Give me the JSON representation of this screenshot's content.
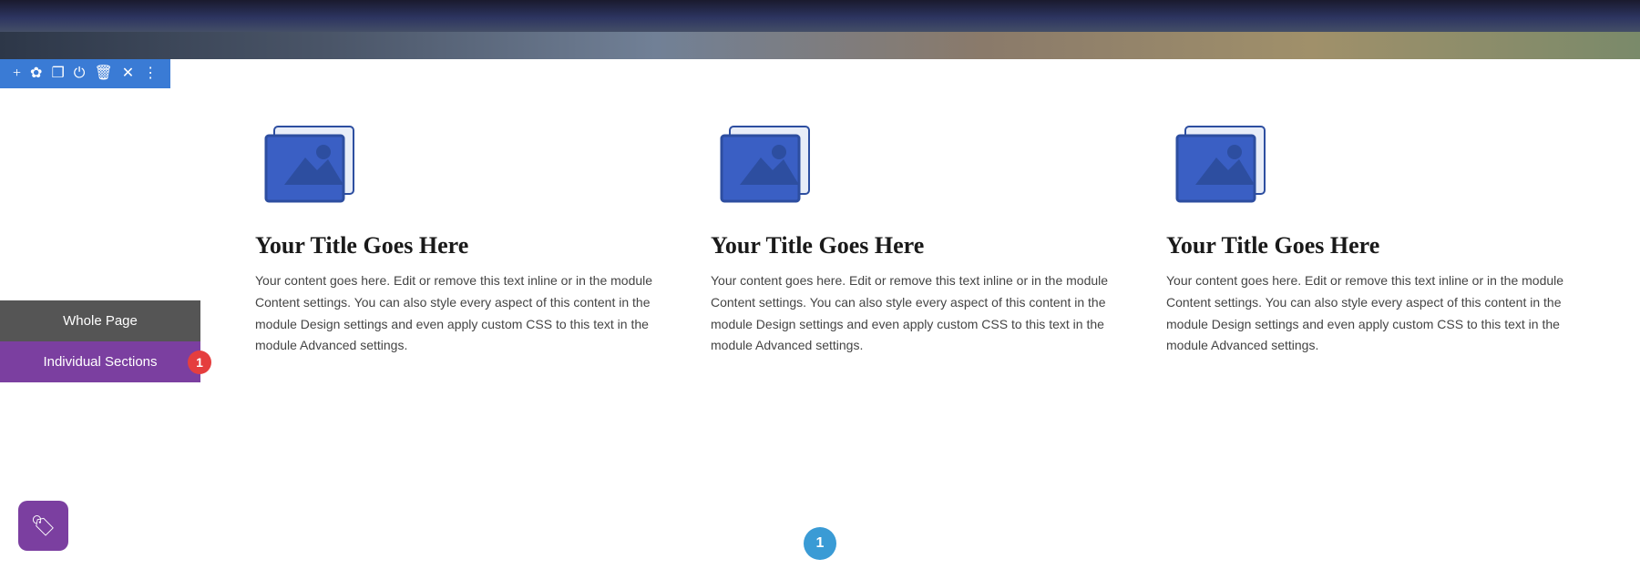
{
  "hero": {
    "alt": "Bridge over water header image"
  },
  "toolbar": {
    "icons": [
      {
        "name": "add",
        "symbol": "+"
      },
      {
        "name": "settings",
        "symbol": "✿"
      },
      {
        "name": "duplicate",
        "symbol": "❐"
      },
      {
        "name": "power",
        "symbol": "⏻"
      },
      {
        "name": "trash",
        "symbol": "🗑"
      },
      {
        "name": "close",
        "symbol": "✕"
      },
      {
        "name": "more",
        "symbol": "⋮"
      }
    ],
    "color": "#3a7bd5"
  },
  "columns": [
    {
      "title": "Your Title Goes Here",
      "text": "Your content goes here. Edit or remove this text inline or in the module Content settings. You can also style every aspect of this content in the module Design settings and even apply custom CSS to this text in the module Advanced settings."
    },
    {
      "title": "Your Title Goes Here",
      "text": "Your content goes here. Edit or remove this text inline or in the module Content settings. You can also style every aspect of this content in the module Design settings and even apply custom CSS to this text in the module Advanced settings."
    },
    {
      "title": "Your Title Goes Here",
      "text": "Your content goes here. Edit or remove this text inline or in the module Content settings. You can also style every aspect of this content in the module Design settings and even apply custom CSS to this text in the module Advanced settings."
    }
  ],
  "sidebar": {
    "whole_page_label": "Whole Page",
    "individual_sections_label": "Individual Sections",
    "badge": "1"
  },
  "float_button": {
    "icon": "🏷",
    "color": "#7b3fa0"
  },
  "pagination": {
    "current": "1",
    "color": "#3a9bd5"
  }
}
